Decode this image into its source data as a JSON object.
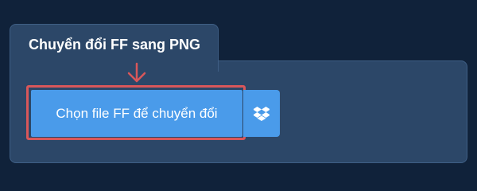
{
  "converter": {
    "tab_title": "Chuyển đổi FF sang PNG",
    "choose_file_label": "Chọn file FF để chuyển đổi",
    "dropbox_icon": "dropbox-icon"
  },
  "colors": {
    "page_background": "#10223a",
    "panel_background": "#2c4768",
    "button_blue": "#4a9bea",
    "highlight_red": "#d9575a"
  }
}
